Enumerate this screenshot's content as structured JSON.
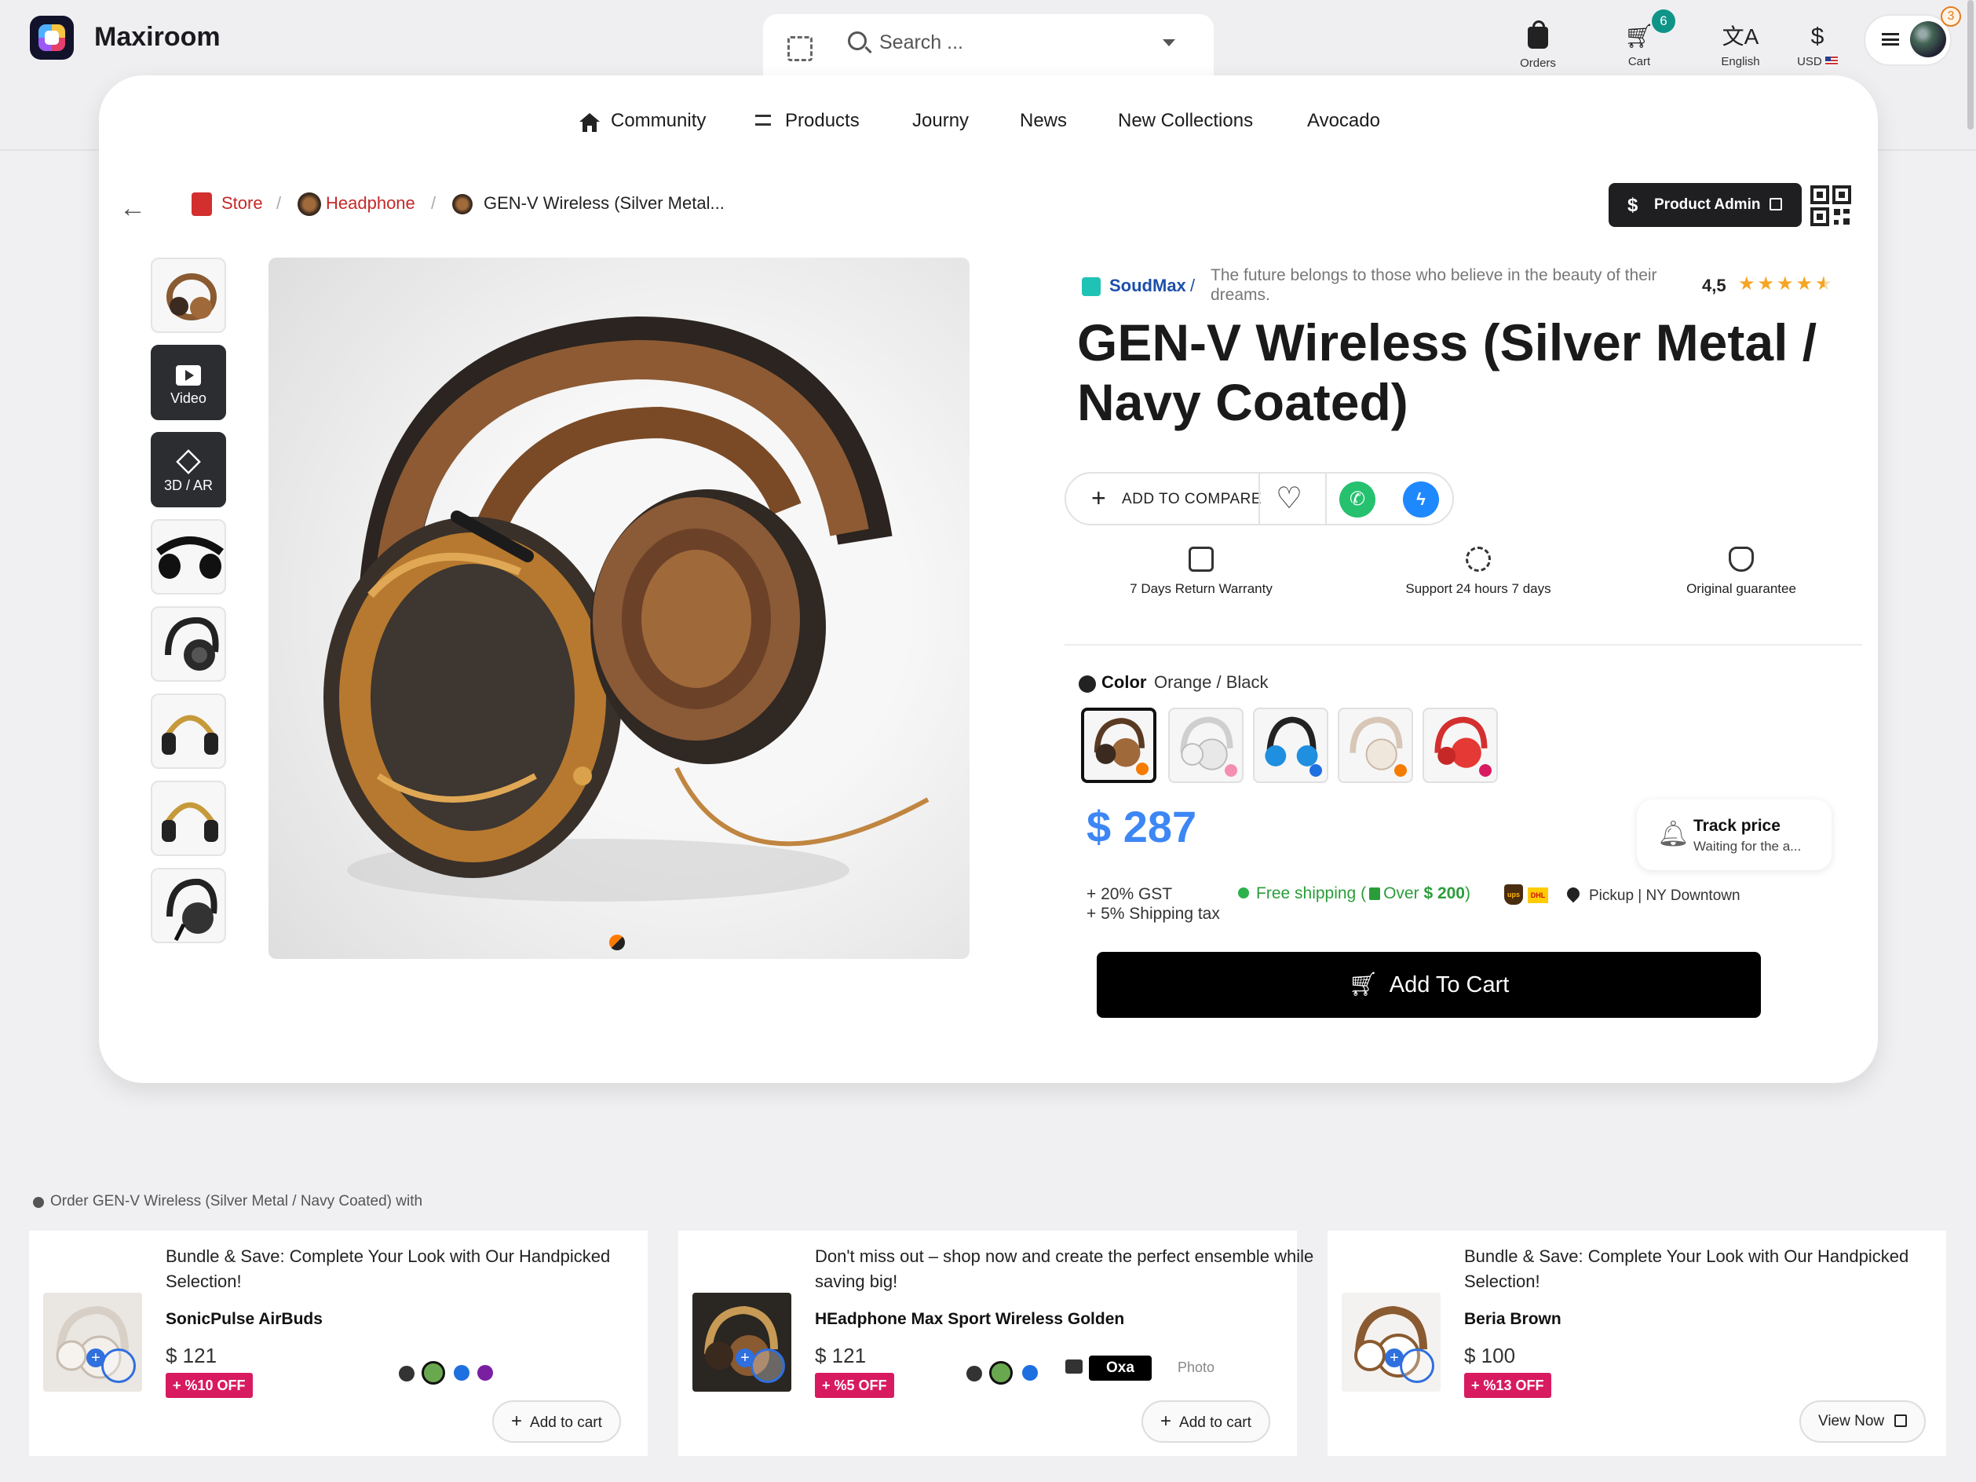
{
  "brand": "Maxiroom",
  "search": {
    "placeholder": "Search ..."
  },
  "toolbar": {
    "orders": "Orders",
    "cart": "Cart",
    "cart_count": "6",
    "language": "English",
    "currency_symbol": "$",
    "currency": "USD",
    "notifications": "3"
  },
  "nav": [
    "Community",
    "Products",
    "Journy",
    "News",
    "New Collections",
    "Avocado"
  ],
  "breadcrumb": {
    "store": "Store",
    "category": "Headphone",
    "current": "GEN-V Wireless (Silver Metal..."
  },
  "product_admin": "Product Admin",
  "media_thumbs": {
    "video": "Video",
    "ar": "3D / AR"
  },
  "shop": {
    "name": "SoudMax",
    "slash": "/",
    "tagline": "The future belongs to those who believe in the beauty of their dreams."
  },
  "rating": {
    "value": "4,5",
    "stars": 4.5
  },
  "product": {
    "title": "GEN-V Wireless (Silver Metal / Navy Coated)",
    "price": "$ 287"
  },
  "actions": {
    "add_to_compare": "ADD TO COMPARE"
  },
  "features": [
    "7 Days Return Warranty",
    "Support 24 hours 7 days",
    "Original guarantee"
  ],
  "color": {
    "label": "Color",
    "value": "Orange / Black",
    "accent": "#3d86f5"
  },
  "track": {
    "title": "Track price",
    "subtitle": "Waiting for the a..."
  },
  "taxes": {
    "gst": "+ 20% GST",
    "shipping_tax": "+ 5% Shipping tax"
  },
  "shipping": {
    "label": "Free shipping",
    "over_prefix": "Over",
    "over_amount": "$ 200"
  },
  "carriers": {
    "ups": "ups",
    "dhl": "DHL"
  },
  "pickup": "Pickup | NY Downtown",
  "add_to_cart": "Add To Cart",
  "bundles": {
    "heading": "Order GEN-V Wireless (Silver Metal / Navy Coated) with",
    "items": [
      {
        "desc": "Bundle & Save: Complete Your Look with Our Handpicked Selection!",
        "name": "SonicPulse AirBuds",
        "price": "$ 121",
        "off": "+ %10 OFF",
        "button": "Add to cart"
      },
      {
        "desc": "Don't miss out – shop now and create the perfect ensemble while saving big!",
        "name": "HEadphone Max Sport Wireless Golden",
        "price": "$ 121",
        "off": "+ %5 OFF",
        "button": "Add to cart",
        "brand_tag": "Oxa",
        "photo_label": "Photo"
      },
      {
        "desc": "Bundle & Save: Complete Your Look with Our Handpicked Selection!",
        "name": "Beria Brown",
        "price": "$ 100",
        "off": "+ %13 OFF",
        "button": "View Now"
      }
    ]
  }
}
